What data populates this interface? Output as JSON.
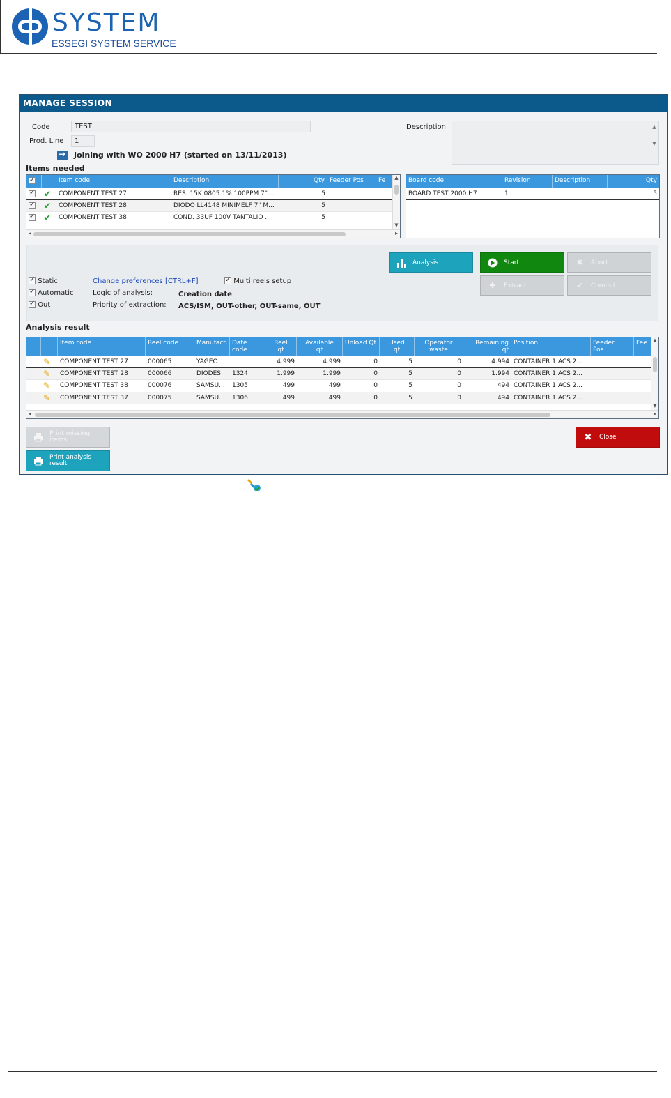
{
  "logo": {
    "word": "SYSTEM",
    "sub": "ESSEGI SYSTEM SERVICE"
  },
  "dialog": {
    "title": "MANAGE SESSION",
    "code_label": "Code",
    "code_value": "TEST",
    "prod_line_label": "Prod. Line",
    "prod_line_value": "1",
    "description_label": "Description",
    "joining_text": "Joining with WO 2000 H7 (started on 13/11/2013)",
    "items_needed_label": "Items needed",
    "analysis_result_label": "Analysis result"
  },
  "items_grid": {
    "headers": [
      "Item code",
      "Description",
      "Qty",
      "Feeder Pos",
      "Fe"
    ],
    "rows": [
      {
        "item": "COMPONENT TEST 27",
        "desc": "RES. 15K 0805 1% 100PPM 7\"...",
        "qty": "5"
      },
      {
        "item": "COMPONENT TEST 28",
        "desc": "DIODO LL4148 MINIMELF 7\" M...",
        "qty": "5"
      },
      {
        "item": "COMPONENT TEST 38",
        "desc": "COND. 33UF 100V TANTALIO ...",
        "qty": "5"
      }
    ]
  },
  "board_grid": {
    "headers": [
      "Board code",
      "Revision",
      "Description",
      "Qty"
    ],
    "rows": [
      {
        "board": "BOARD TEST 2000 H7",
        "revision": "1",
        "desc": "",
        "qty": "5"
      }
    ]
  },
  "options": {
    "static_label": "Static",
    "automatic_label": "Automatic",
    "out_label": "Out",
    "change_prefs_link": "Change preferences [CTRL+F]",
    "multi_reels_label": "Multi reels setup",
    "logic_label": "Logic of analysis:",
    "logic_value": "Creation date",
    "priority_label": "Priority of extraction:",
    "priority_value": "ACS/ISM, OUT-other, OUT-same, OUT"
  },
  "buttons": {
    "analysis": "Analysis",
    "start": "Start",
    "abort": "Abort",
    "extract": "Extract",
    "commit": "Commit",
    "print_missing_1": "Print missing",
    "print_missing_2": "items",
    "print_analysis_1": "Print analysis",
    "print_analysis_2": "result",
    "close": "Close"
  },
  "analysis_grid": {
    "headers": [
      [
        "Item code",
        ""
      ],
      [
        "Reel code",
        ""
      ],
      [
        "Manufact.",
        ""
      ],
      [
        "Date",
        "code"
      ],
      [
        "Reel",
        "qt"
      ],
      [
        "Available",
        "qt"
      ],
      [
        "Unload Qt",
        ""
      ],
      [
        "Used",
        "qt"
      ],
      [
        "Operator",
        "waste"
      ],
      [
        "Remaining",
        "qt"
      ],
      [
        "Position",
        ""
      ],
      [
        "Feeder",
        "Pos"
      ],
      [
        "Fee",
        ""
      ]
    ],
    "rows": [
      {
        "item": "COMPONENT TEST 27",
        "reel": "000065",
        "manuf": "YAGEO",
        "date": "",
        "reel_qt": "4.999",
        "avail": "4.999",
        "unload": "0",
        "used": "5",
        "waste": "0",
        "remaining": "4.994",
        "position": "CONTAINER 1 ACS 2..."
      },
      {
        "item": "COMPONENT TEST 28",
        "reel": "000066",
        "manuf": "DIODES",
        "date": "1324",
        "reel_qt": "1.999",
        "avail": "1.999",
        "unload": "0",
        "used": "5",
        "waste": "0",
        "remaining": "1.994",
        "position": "CONTAINER 1 ACS 2..."
      },
      {
        "item": "COMPONENT TEST 38",
        "reel": "000076",
        "manuf": "SAMSU...",
        "date": "1305",
        "reel_qt": "499",
        "avail": "499",
        "unload": "0",
        "used": "5",
        "waste": "0",
        "remaining": "494",
        "position": "CONTAINER 1 ACS 2..."
      },
      {
        "item": "COMPONENT TEST 37",
        "reel": "000075",
        "manuf": "SAMSU...",
        "date": "1306",
        "reel_qt": "499",
        "avail": "499",
        "unload": "0",
        "used": "5",
        "waste": "0",
        "remaining": "494",
        "position": "CONTAINER 1 ACS 2..."
      }
    ]
  }
}
